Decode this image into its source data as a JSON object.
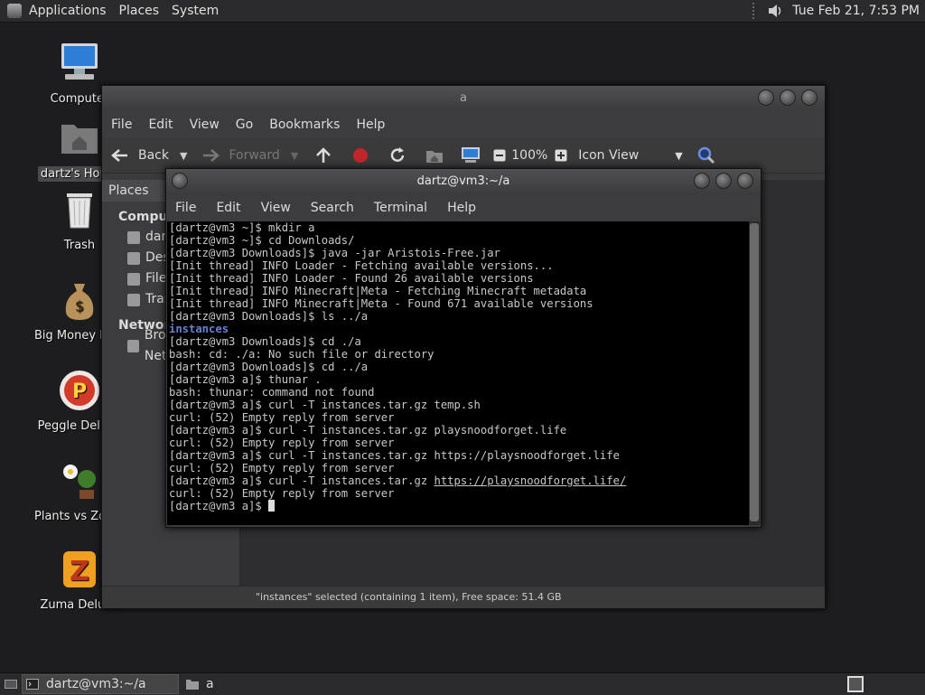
{
  "top_panel": {
    "menus": [
      "Applications",
      "Places",
      "System"
    ],
    "clock": "Tue Feb 21,  7:53 PM"
  },
  "desktop": {
    "icons": [
      {
        "label": "Computer"
      },
      {
        "label": "dartz's Home"
      },
      {
        "label": "Trash"
      },
      {
        "label": "Big Money Deluxe"
      },
      {
        "label": "Peggle Deluxe"
      },
      {
        "label": "Plants vs Zombies"
      },
      {
        "label": "Zuma Deluxe"
      }
    ]
  },
  "file_manager": {
    "title": "a",
    "menus": [
      "File",
      "Edit",
      "View",
      "Go",
      "Bookmarks",
      "Help"
    ],
    "toolbar": {
      "back": "Back",
      "forward": "Forward",
      "zoom": "100%",
      "view_mode": "Icon View"
    },
    "sidebar": {
      "header": "Places",
      "sections": [
        {
          "title": "Computer",
          "items": [
            "dartz",
            "Desktop",
            "File System",
            "Trash"
          ]
        },
        {
          "title": "Network",
          "items": [
            "Browse Network"
          ]
        }
      ]
    },
    "status": "\"instances\" selected (containing 1 item), Free space: 51.4 GB"
  },
  "terminal": {
    "title": "dartz@vm3:~/a",
    "menus": [
      "File",
      "Edit",
      "View",
      "Search",
      "Terminal",
      "Help"
    ],
    "lines": [
      "[dartz@vm3 ~]$ mkdir a",
      "[dartz@vm3 ~]$ cd Downloads/",
      "[dartz@vm3 Downloads]$ java -jar Aristois-Free.jar",
      "[Init thread] INFO Loader - Fetching available versions...",
      "[Init thread] INFO Loader - Found 26 available versions",
      "[Init thread] INFO Minecraft|Meta - Fetching Minecraft metadata",
      "[Init thread] INFO Minecraft|Meta - Found 671 available versions",
      "[dartz@vm3 Downloads]$ ls ../a",
      "instances",
      "[dartz@vm3 Downloads]$ cd ./a",
      "bash: cd: ./a: No such file or directory",
      "[dartz@vm3 Downloads]$ cd ../a",
      "[dartz@vm3 a]$ thunar .",
      "bash: thunar: command not found",
      "[dartz@vm3 a]$ curl -T instances.tar.gz temp.sh",
      "curl: (52) Empty reply from server",
      "[dartz@vm3 a]$ curl -T instances.tar.gz playsnoodforget.life",
      "curl: (52) Empty reply from server",
      "[dartz@vm3 a]$ curl -T instances.tar.gz https://playsnoodforget.life",
      "curl: (52) Empty reply from server",
      "[dartz@vm3 a]$ curl -T instances.tar.gz ",
      "https://playsnoodforget.life/",
      "curl: (52) Empty reply from server",
      "[dartz@vm3 a]$ "
    ]
  },
  "taskbar": {
    "tasks": [
      "dartz@vm3:~/a",
      "a"
    ]
  }
}
